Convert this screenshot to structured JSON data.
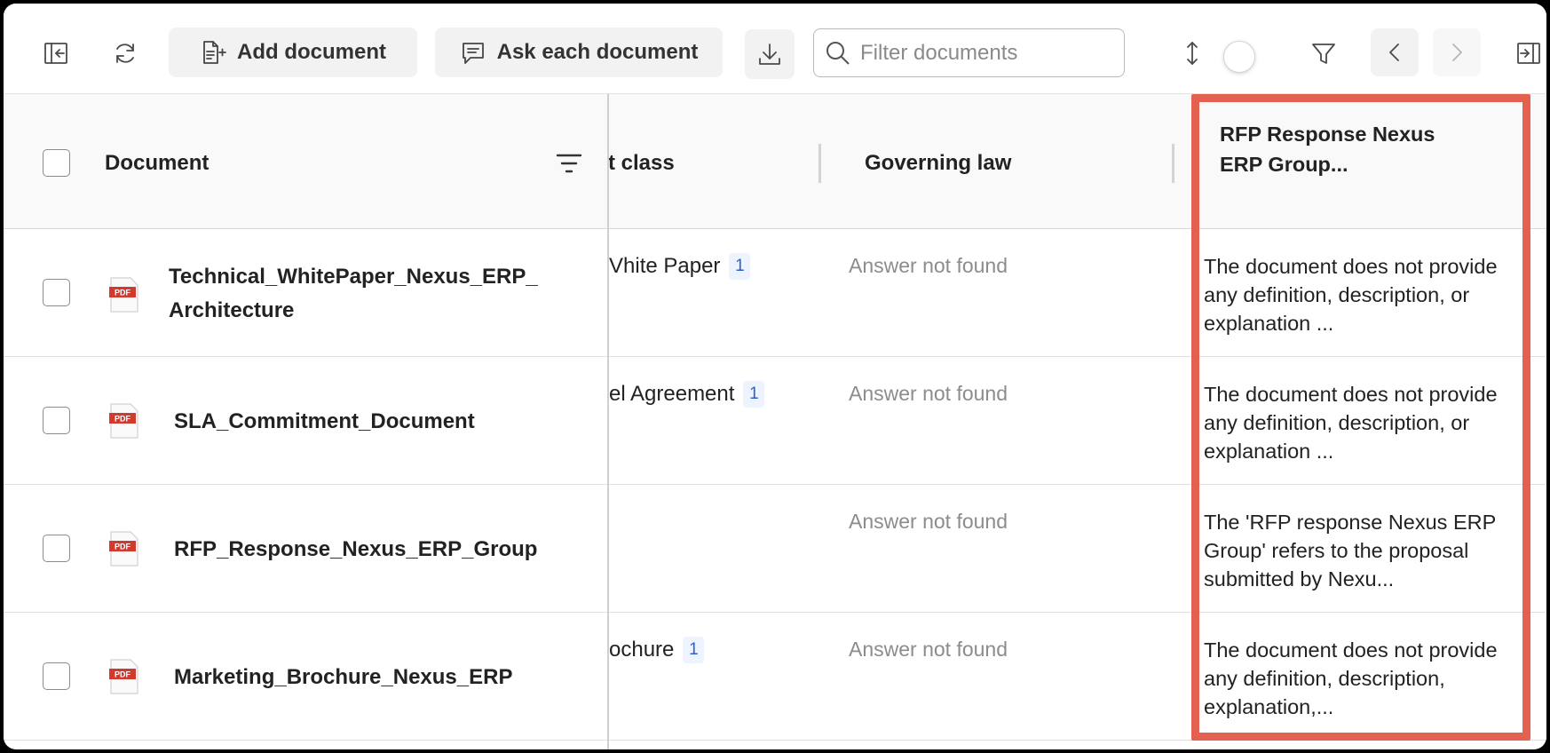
{
  "toolbar": {
    "add_document_label": "Add document",
    "ask_each_label": "Ask each document",
    "filter_placeholder": "Filter documents"
  },
  "table": {
    "headers": {
      "document": "Document",
      "class": "t class",
      "governing_law": "Governing law",
      "rfp": "RFP Response Nexus ERP Group..."
    },
    "rows": [
      {
        "doc_name": "Technical_WhitePaper_Nexus_ERP_ Architecture",
        "class_value": "Vhite Paper",
        "class_badge": "1",
        "law": "Answer not found",
        "rfp": "The document does not provide any definition, description, or explanation ..."
      },
      {
        "doc_name": "SLA_Commitment_Document",
        "class_value": "el Agreement",
        "class_badge": "1",
        "law": "Answer not found",
        "rfp": "The document does not provide any definition, description, or explanation ..."
      },
      {
        "doc_name": "RFP_Response_Nexus_ERP_Group",
        "class_value": "",
        "class_badge": "",
        "law": "Answer not found",
        "rfp": "The 'RFP response Nexus ERP Group' refers to the proposal submitted by Nexu..."
      },
      {
        "doc_name": "Marketing_Brochure_Nexus_ERP",
        "class_value": "ochure",
        "class_badge": "1",
        "law": "Answer not found",
        "rfp": "The document does not provide any definition, description, explanation,..."
      }
    ]
  },
  "icons": {
    "pdf_label": "PDF"
  },
  "colors": {
    "highlight": "#e4604f",
    "badge_text": "#2f5fd1",
    "pdf_red": "#d23a2f"
  }
}
